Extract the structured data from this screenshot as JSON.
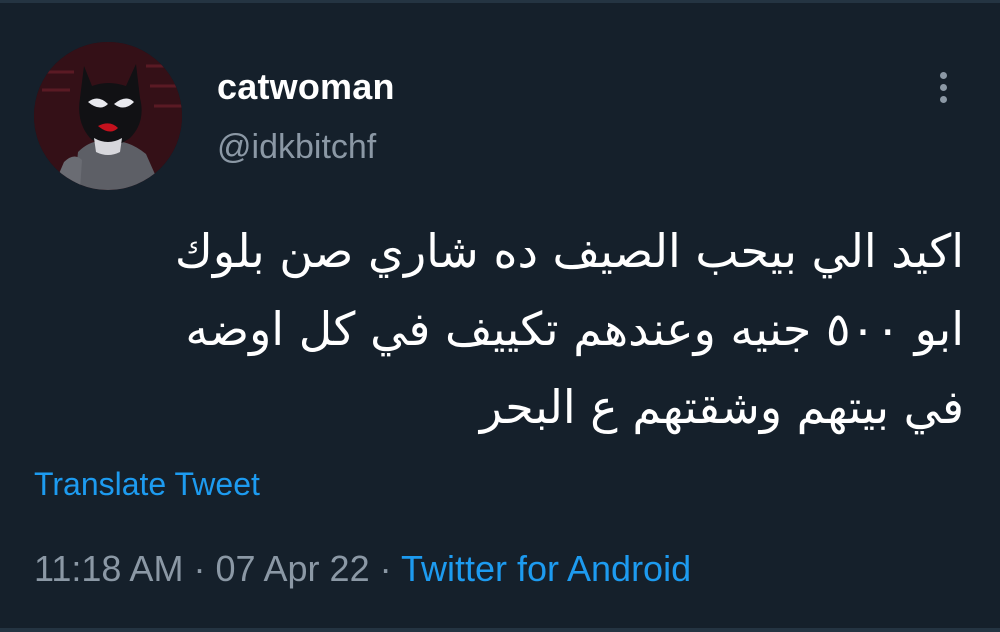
{
  "tweet": {
    "display_name": "catwoman",
    "handle": "@idkbitchf",
    "text_lines": [
      "اكيد الي بيحب الصيف ده شاري صن بلوك",
      "ابو ٥٠٠ جنيه وعندهم تكييف في كل اوضه",
      "في بيتهم وشقتهم ع البحر"
    ],
    "translate_label": "Translate Tweet",
    "time": "11:18 AM",
    "separator": "·",
    "date": "07 Apr 22",
    "source": "Twitter for Android"
  },
  "icons": {
    "avatar": "catwoman-avatar",
    "more": "more-options-icon"
  },
  "colors": {
    "background": "#15202b",
    "primary_text": "#ffffff",
    "secondary_text": "#8b98a5",
    "accent": "#1d9bf0"
  }
}
